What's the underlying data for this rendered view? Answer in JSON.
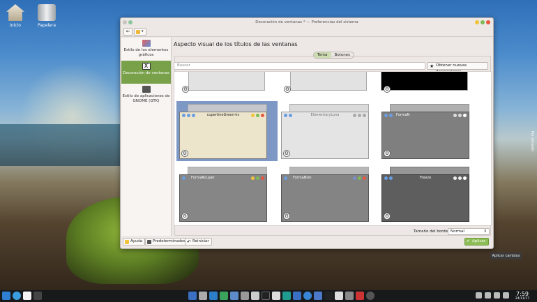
{
  "desktop": {
    "icons": [
      {
        "label": "Inicio",
        "icon": "home-folder-icon"
      },
      {
        "label": "Papelera",
        "icon": "trash-icon"
      }
    ],
    "right_edge_label": "Por omisión"
  },
  "window": {
    "title": "Decoración de ventanas * — Preferencias del sistema"
  },
  "sidebar": {
    "items": [
      {
        "label": "Estilo de los elementos gráficos",
        "active": false
      },
      {
        "label": "Decoración de ventanas",
        "active": true
      },
      {
        "label": "Estilo de aplicaciones de GNOME (GTK)",
        "active": false
      }
    ]
  },
  "main": {
    "heading": "Aspecto visual de los títulos de las ventanas",
    "tabs": [
      {
        "label": "Tema",
        "active": true
      },
      {
        "label": "Botones",
        "active": false
      }
    ],
    "search_placeholder": "Buscar",
    "get_new_label": "Obtener nuevas decoraciones...",
    "themes": [
      {
        "title": "cupertinoGreen-kv",
        "selected": true
      },
      {
        "title": "ElementaryLuna",
        "selected": false
      },
      {
        "title": "FormaN",
        "selected": false
      },
      {
        "title": "FormaNcuper",
        "selected": false
      },
      {
        "title": "FormaNish",
        "selected": false
      },
      {
        "title": "Freeze",
        "selected": false
      }
    ],
    "border_size_label": "Tamaño del borde:",
    "border_size_value": "Normal"
  },
  "footer": {
    "help": "Ayuda",
    "defaults": "Predeterminados",
    "reset": "Reiniciar",
    "apply": "Aplicar"
  },
  "tooltip": "Aplicar cambios",
  "taskbar": {
    "time": "7:59",
    "date": "24/11/17"
  },
  "colors": {
    "accent": "#78a14a",
    "selection": "#7e98c6",
    "apply": "#8dbd56"
  }
}
